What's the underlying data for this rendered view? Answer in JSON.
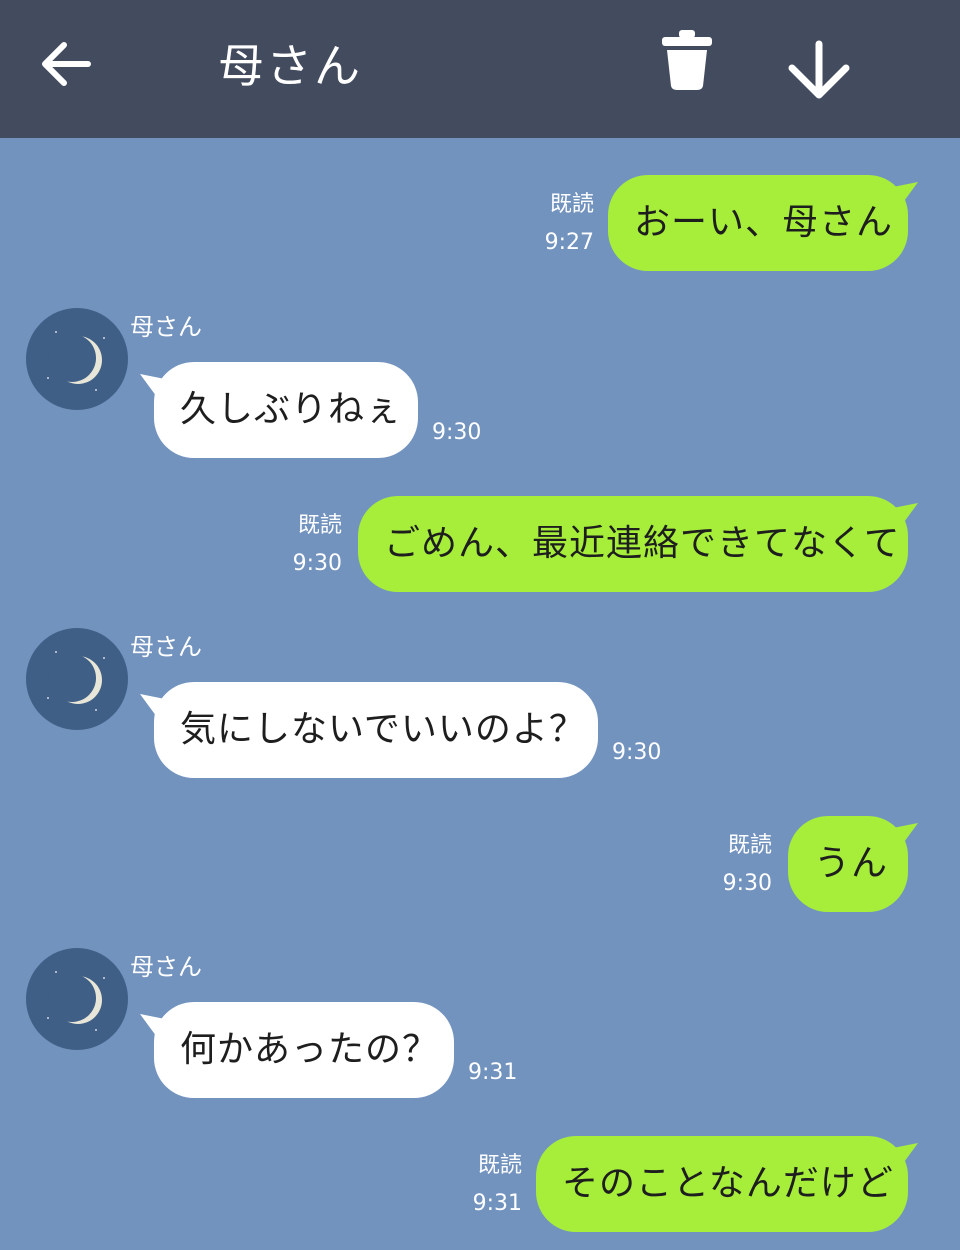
{
  "header": {
    "title": "母さん",
    "back_icon": "arrow-left-icon",
    "trash_icon": "trash-icon",
    "download_icon": "arrow-down-icon"
  },
  "colors": {
    "header_bg": "#434b5e",
    "chat_bg": "#7393bf",
    "outgoing_bubble": "#a6ee3a",
    "incoming_bubble": "#ffffff"
  },
  "messages": [
    {
      "direction": "outgoing",
      "text": "おーい、母さん",
      "read_label": "既読",
      "time": "9:27"
    },
    {
      "direction": "incoming",
      "sender": "母さん",
      "text": "久しぶりねぇ",
      "time": "9:30"
    },
    {
      "direction": "outgoing",
      "text": "ごめん、最近連絡できてなくて",
      "read_label": "既読",
      "time": "9:30"
    },
    {
      "direction": "incoming",
      "sender": "母さん",
      "text": "気にしないでいいのよ？",
      "time": "9:30"
    },
    {
      "direction": "outgoing",
      "text": "うん",
      "read_label": "既読",
      "time": "9:30"
    },
    {
      "direction": "incoming",
      "sender": "母さん",
      "text": "何かあったの？",
      "time": "9:31"
    },
    {
      "direction": "outgoing",
      "text": "そのことなんだけど",
      "read_label": "既読",
      "time": "9:31"
    }
  ]
}
